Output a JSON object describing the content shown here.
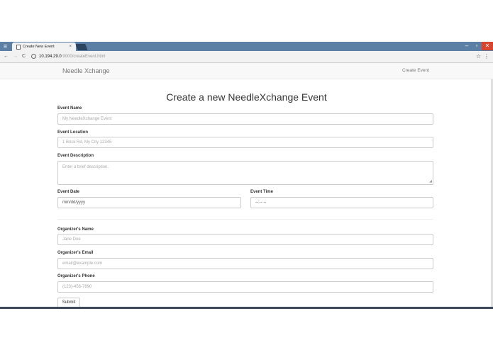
{
  "browser": {
    "tab_title": "Create New Event",
    "tab_close": "×",
    "url_host": "10.194.29.0",
    "url_path": ":9000/createEvent.html",
    "win_min": "–",
    "win_max": "▫",
    "win_close": "✕",
    "back": "←",
    "forward": "→",
    "reload": "C",
    "star": "☆",
    "menu": "⋮"
  },
  "navbar": {
    "brand": "Needle Xchange",
    "link": "Create Event"
  },
  "page": {
    "title": "Create a new NeedleXchange Event"
  },
  "form": {
    "event_name": {
      "label": "Event Name",
      "placeholder": "My NeedleXchange Event"
    },
    "event_location": {
      "label": "Event Location",
      "placeholder": "1 Brick Rd, My City 12345"
    },
    "event_description": {
      "label": "Event Description",
      "placeholder": "Enter a brief description."
    },
    "event_date": {
      "label": "Event Date",
      "value": "mm/dd/yyyy"
    },
    "event_time": {
      "label": "Event Time",
      "value": "--:-- --"
    },
    "organizer_name": {
      "label": "Organizer's Name",
      "placeholder": "Jane Doe"
    },
    "organizer_email": {
      "label": "Organizer's Email",
      "placeholder": "email@example.com"
    },
    "organizer_phone": {
      "label": "Organizer's Phone",
      "placeholder": "(123)-456-7890"
    },
    "submit_label": "Submit"
  }
}
